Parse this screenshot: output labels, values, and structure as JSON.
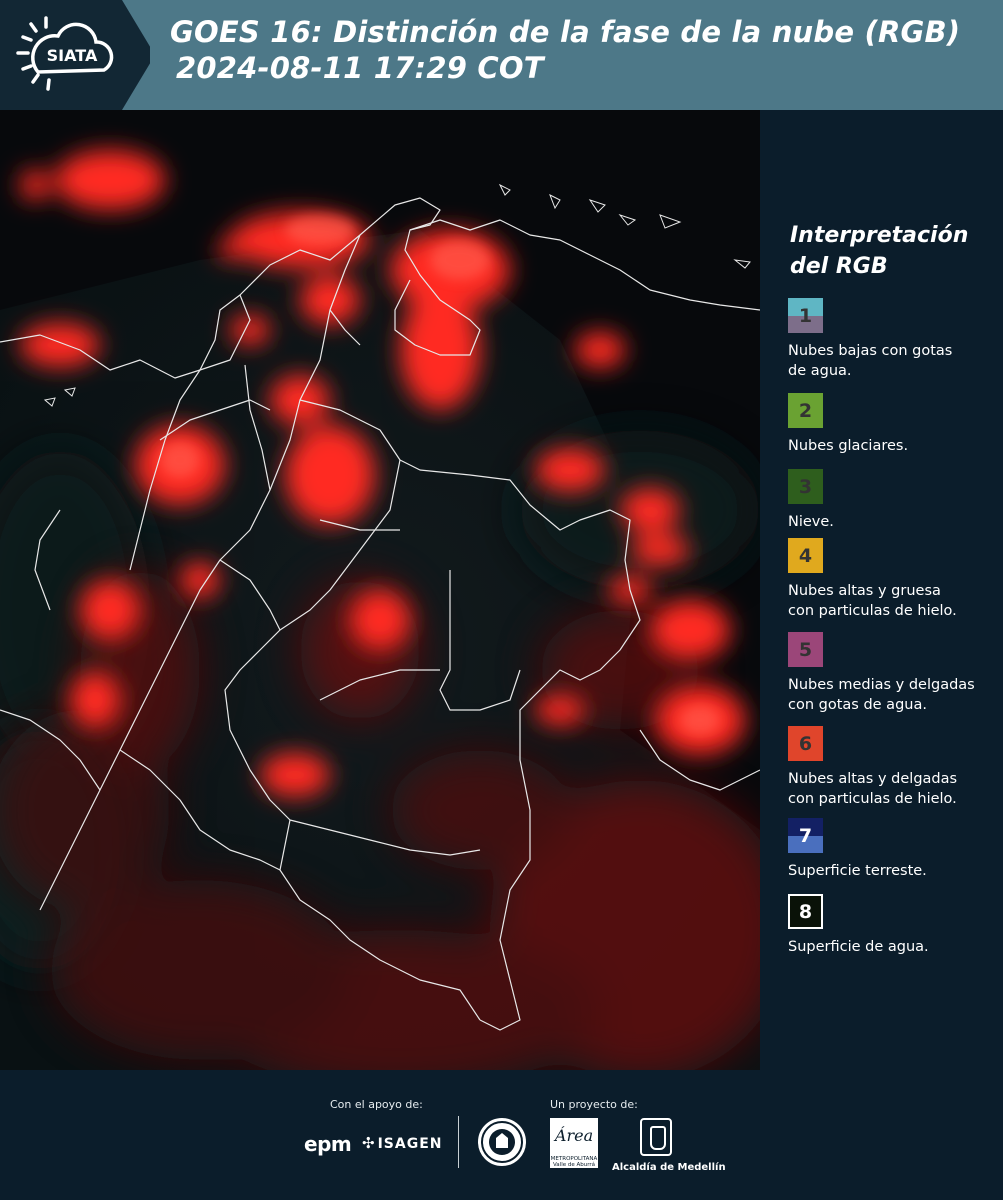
{
  "header": {
    "logo_text": "SIATA",
    "title_line1": "GOES 16: Distinción de la fase de la nube (RGB)",
    "title_line2": "2024-08-11 17:29 COT",
    "background_color": "#4d7888"
  },
  "legend": {
    "title_line1": "Interpretación",
    "title_line2": "del RGB",
    "items": [
      {
        "number": "1",
        "desc_line1": "Nubes bajas con gotas",
        "desc_line2": "de agua.",
        "color_top": "#5fb6c4",
        "color_bottom": "#7d6e8a"
      },
      {
        "number": "2",
        "desc_line1": "Nubes glaciares.",
        "desc_line2": "",
        "color_top": "#6aa232",
        "color_bottom": "#6aa232"
      },
      {
        "number": "3",
        "desc_line1": "Nieve.",
        "desc_line2": "",
        "color_top": "#2e5e1d",
        "color_bottom": "#2e5e1d"
      },
      {
        "number": "4",
        "desc_line1": "Nubes altas y gruesa",
        "desc_line2": "con particulas de hielo.",
        "color_top": "#e0a91e",
        "color_bottom": "#e0a91e"
      },
      {
        "number": "5",
        "desc_line1": "Nubes medias y delgadas",
        "desc_line2": "con gotas de agua.",
        "color_top": "#9b4679",
        "color_bottom": "#9b4679"
      },
      {
        "number": "6",
        "desc_line1": "Nubes altas y delgadas",
        "desc_line2": "con particulas de hielo.",
        "color_top": "#e0452b",
        "color_bottom": "#e0452b"
      },
      {
        "number": "7",
        "desc_line1": "Superficie terreste.",
        "desc_line2": "",
        "color_top": "#132064",
        "color_bottom": "#4a6fbe"
      },
      {
        "number": "8",
        "desc_line1": "Superficie de agua.",
        "desc_line2": "",
        "color_top": "#0a1208",
        "color_bottom": "#0a1208"
      }
    ]
  },
  "footer": {
    "support_label": "Con el apoyo de:",
    "project_label": "Un proyecto de:",
    "epm_logo": "epm",
    "isagen_logo": "ISAGEN",
    "area_logo": "Área",
    "area_sub": "METROPOLITANA Valle de Aburrá",
    "alcaldia_logo": "Alcaldía de Medellín"
  }
}
